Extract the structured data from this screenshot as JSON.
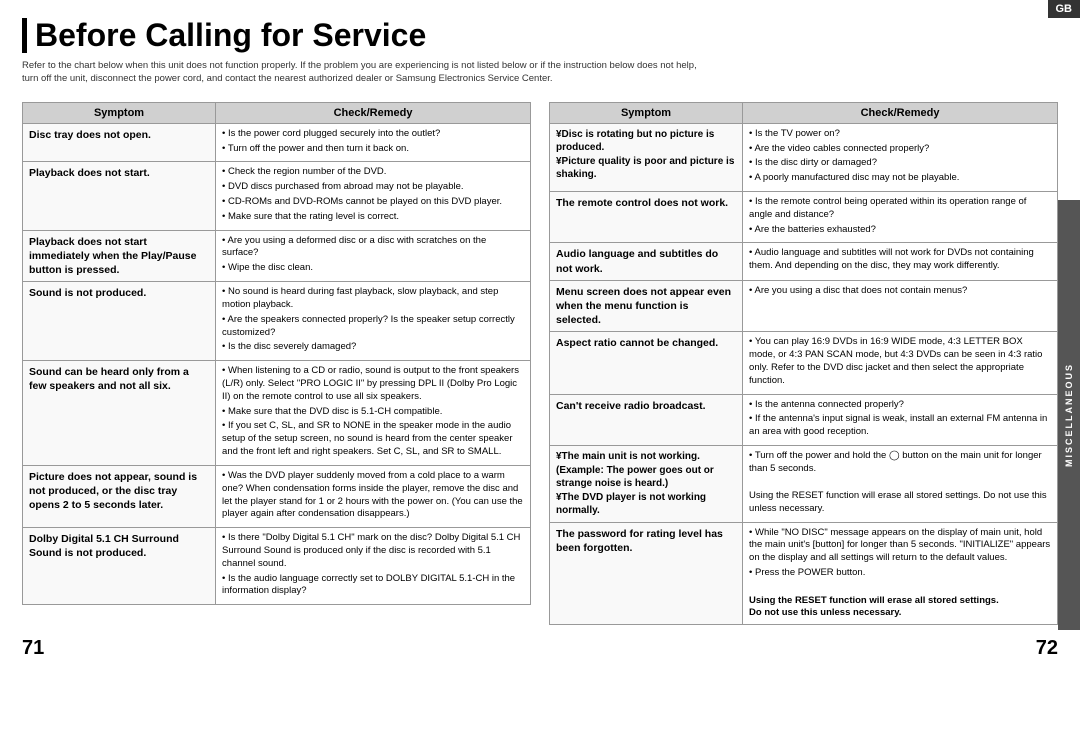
{
  "gb_badge": "GB",
  "title": "Before Calling for Service",
  "subtitle": "Refer to the chart below when this unit does not function properly. If the problem you are experiencing is not listed below or if the instruction below does not help, turn off the unit, disconnect the power cord, and contact the nearest authorized dealer or Samsung Electronics Service Center.",
  "page_numbers": {
    "left": "71",
    "right": "72"
  },
  "misc_label": "MISCELLANEOUS",
  "left_table": {
    "headers": [
      "Symptom",
      "Check/Remedy"
    ],
    "rows": [
      {
        "symptom": "Disc tray does not open.",
        "remedy_bullets": [
          "Is the power cord plugged securely into the outlet?",
          "Turn off the power and then turn it back on."
        ]
      },
      {
        "symptom": "Playback does not start.",
        "remedy_bullets": [
          "Check the region number of the DVD.",
          "DVD discs purchased from abroad may not be playable.",
          "CD-ROMs and DVD-ROMs cannot be played on this DVD player.",
          "Make sure that the rating level is correct."
        ]
      },
      {
        "symptom": "Playback does not start immediately when the Play/Pause button is pressed.",
        "remedy_bullets": [
          "Are you using a deformed disc or a disc with scratches on the surface?",
          "Wipe the disc clean."
        ]
      },
      {
        "symptom": "Sound is not produced.",
        "remedy_bullets": [
          "No sound is heard during fast playback, slow playback, and step motion playback.",
          "Are the speakers connected properly? Is the speaker setup correctly customized?",
          "Is the disc severely damaged?"
        ]
      },
      {
        "symptom": "Sound can be heard only from a few speakers and not all six.",
        "remedy_bullets": [
          "When listening to a CD or radio, sound is output to the front speakers (L/R) only. Select \"PRO LOGIC II\" by pressing DPL II (Dolby Pro Logic II) on the remote control to use all six speakers.",
          "Make sure that the DVD disc is 5.1-CH compatible.",
          "If you set C, SL, and SR to NONE in the speaker mode in the audio setup of the setup screen, no sound is heard from the center speaker and the front left and right speakers. Set C, SL, and SR to SMALL."
        ]
      },
      {
        "symptom": "Picture does not appear, sound is not produced, or the disc tray opens 2 to 5 seconds later.",
        "remedy_bullets": [
          "Was the DVD player suddenly moved from a cold place to a warm one? When condensation forms inside the player, remove the disc and let the player stand for 1 or 2 hours with the power on. (You can use the player again after condensation disappears.)"
        ]
      },
      {
        "symptom": "Dolby Digital 5.1 CH Surround Sound is not produced.",
        "remedy_bullets": [
          "Is there \"Dolby Digital 5.1 CH\" mark on the disc? Dolby Digital 5.1 CH Surround Sound is produced only if the disc is recorded with 5.1 channel sound.",
          "Is the audio language correctly set to DOLBY DIGITAL 5.1-CH in the information display?"
        ]
      }
    ]
  },
  "right_table": {
    "headers": [
      "Symptom",
      "Check/Remedy"
    ],
    "rows": [
      {
        "symptom": "¥Disc is rotating but no picture is produced.\n¥Picture quality is poor and picture is shaking.",
        "remedy_bullets": [
          "Is the TV power on?",
          "Are the video cables connected properly?",
          "Is the disc dirty or damaged?",
          "A poorly manufactured disc may not be playable."
        ]
      },
      {
        "symptom": "The remote control does not work.",
        "remedy_bullets": [
          "Is the remote control being operated within its operation range of angle and distance?",
          "Are the batteries exhausted?"
        ]
      },
      {
        "symptom": "Audio language and subtitles do not work.",
        "remedy_bullets": [
          "Audio language and subtitles will not work for DVDs not containing them. And depending on the disc, they may work differently."
        ]
      },
      {
        "symptom": "Menu screen does not appear even when the menu function is selected.",
        "remedy_bullets": [
          "Are you using a disc that does not contain menus?"
        ]
      },
      {
        "symptom": "Aspect ratio cannot be changed.",
        "remedy_bullets": [
          "You can play 16:9 DVDs in 16:9 WIDE mode, 4:3 LETTER BOX mode, or 4:3 PAN SCAN mode, but 4:3 DVDs can be seen in 4:3 ratio only. Refer to the DVD disc jacket and then select the appropriate function."
        ]
      },
      {
        "symptom": "Can't receive radio broadcast.",
        "remedy_bullets": [
          "Is the antenna connected properly?",
          "If the antenna's input signal is weak, install an external FM antenna in an area with good reception."
        ]
      },
      {
        "symptom": "¥The main unit is not working.\n(Example: The power goes out or strange noise is heard.)\n¥The DVD player is not working normally.",
        "remedy_bullets_split": [
          {
            "text": "Turn off the power and hold the [button] button on the main unit for longer than 5 seconds.",
            "separator": true
          },
          {
            "text": "Using the RESET function will erase all stored settings. Do not use this unless necessary.",
            "separator": false
          }
        ]
      },
      {
        "symptom": "The password for rating level has been forgotten.",
        "remedy_bullets": [
          "While \"NO DISC\" message appears on the display of main unit, hold the main unit's [button] for longer than 5 seconds. \"INITIALIZE\" appears on the display and all settings will return to the default values.",
          "Press the POWER button."
        ],
        "remedy_bold_note": "Using the RESET function will erase all stored settings.\nDo not use this unless necessary."
      }
    ]
  }
}
